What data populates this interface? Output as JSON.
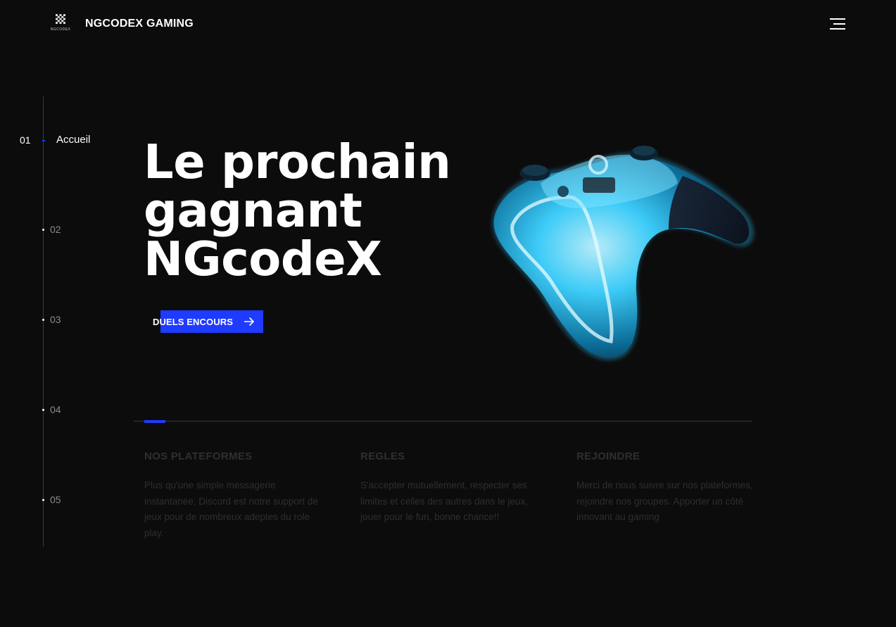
{
  "header": {
    "logo_text": "NGCODEX",
    "brand": "NGCODEX GAMING",
    "menu_icon": "hamburger-menu-icon"
  },
  "nav": {
    "items": [
      {
        "number": "01",
        "label": "Accueil",
        "active": true
      },
      {
        "number": "02",
        "label": "",
        "active": false
      },
      {
        "number": "03",
        "label": "",
        "active": false
      },
      {
        "number": "04",
        "label": "",
        "active": false
      },
      {
        "number": "05",
        "label": "",
        "active": false
      }
    ]
  },
  "hero": {
    "title_lines": [
      "Le prochain",
      "gagnant",
      "NGcodeX"
    ],
    "cta_label": "DUELS ENCOURS",
    "cta_icon": "arrow-right-icon",
    "image_icon": "game-controller-image"
  },
  "features": [
    {
      "title": "NOS PLATEFORMES",
      "text": "Plus qu'une simple messagerie instantanée, Discord est notre support de jeux pour de nombreux adeptes du role play."
    },
    {
      "title": "REGLES",
      "text": "S'accepter mutuellement, respecter ses limites et celles des autres dans le jeux, jouer pour le fun, bonne chance!!"
    },
    {
      "title": "REJOINDRE",
      "text": "Merci de nous suivre sur nos plateformes, rejoindre nos groupes. Apporter un côté innovant au gaming"
    }
  ],
  "colors": {
    "background": "#0c0c0d",
    "accent": "#1f3bff",
    "controller_glow": "#3fd2ff"
  }
}
